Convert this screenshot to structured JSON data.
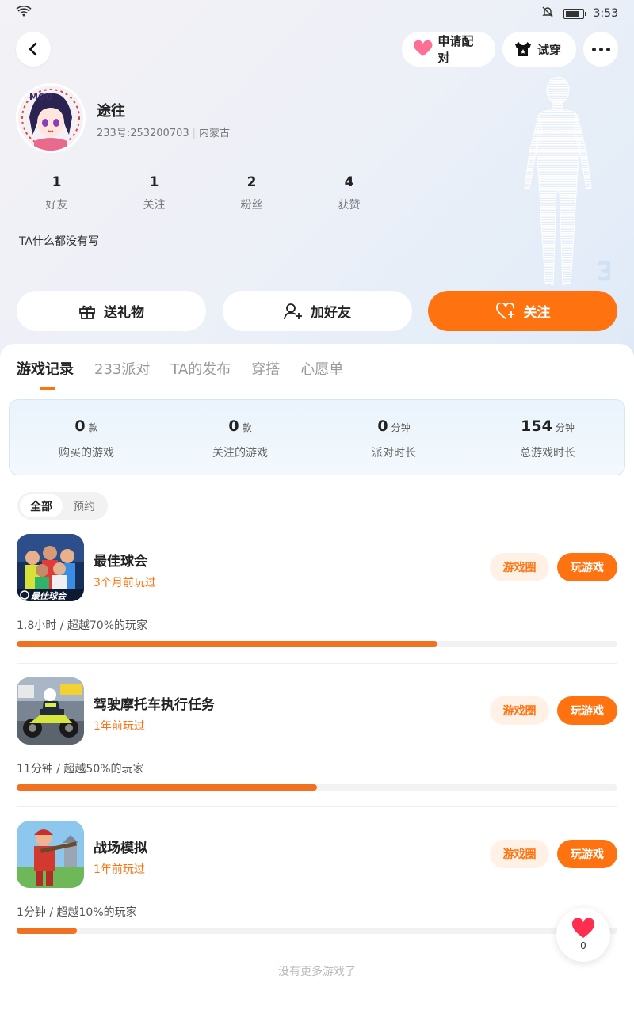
{
  "status": {
    "time": "3:53"
  },
  "header": {
    "pair_label": "申请配对",
    "tryon_label": "试穿"
  },
  "profile": {
    "nickname": "途往",
    "id_text": "233号:253200703",
    "region": "内蒙古",
    "bio": "TA什么都没有写",
    "stats": [
      {
        "num": "1",
        "label": "好友"
      },
      {
        "num": "1",
        "label": "关注"
      },
      {
        "num": "2",
        "label": "粉丝"
      },
      {
        "num": "4",
        "label": "获赞"
      }
    ]
  },
  "actions": {
    "gift": "送礼物",
    "add_friend": "加好友",
    "follow": "关注"
  },
  "tabs": [
    "游戏记录",
    "233派对",
    "TA的发布",
    "穿搭",
    "心愿单"
  ],
  "summary": [
    {
      "value": "0",
      "unit": "款",
      "label": "购买的游戏"
    },
    {
      "value": "0",
      "unit": "款",
      "label": "关注的游戏"
    },
    {
      "value": "0",
      "unit": "分钟",
      "label": "派对时长"
    },
    {
      "value": "154",
      "unit": "分钟",
      "label": "总游戏时长"
    }
  ],
  "filter": {
    "all": "全部",
    "reserve": "预约"
  },
  "games": [
    {
      "name": "最佳球会",
      "played": "3个月前玩过",
      "stat": "1.8小时 / 超越70%的玩家",
      "progress": 0.7,
      "circle": "游戏圈",
      "play": "玩游戏"
    },
    {
      "name": "驾驶摩托车执行任务",
      "played": "1年前玩过",
      "stat": "11分钟 / 超越50%的玩家",
      "progress": 0.5,
      "circle": "游戏圈",
      "play": "玩游戏"
    },
    {
      "name": "战场模拟",
      "played": "1年前玩过",
      "stat": "1分钟 / 超越10%的玩家",
      "progress": 0.1,
      "circle": "游戏圈",
      "play": "玩游戏"
    }
  ],
  "no_more": "没有更多游戏了",
  "like": {
    "count": "0"
  },
  "colors": {
    "accent": "#ff7210",
    "accent_light": "#fff1e6"
  }
}
